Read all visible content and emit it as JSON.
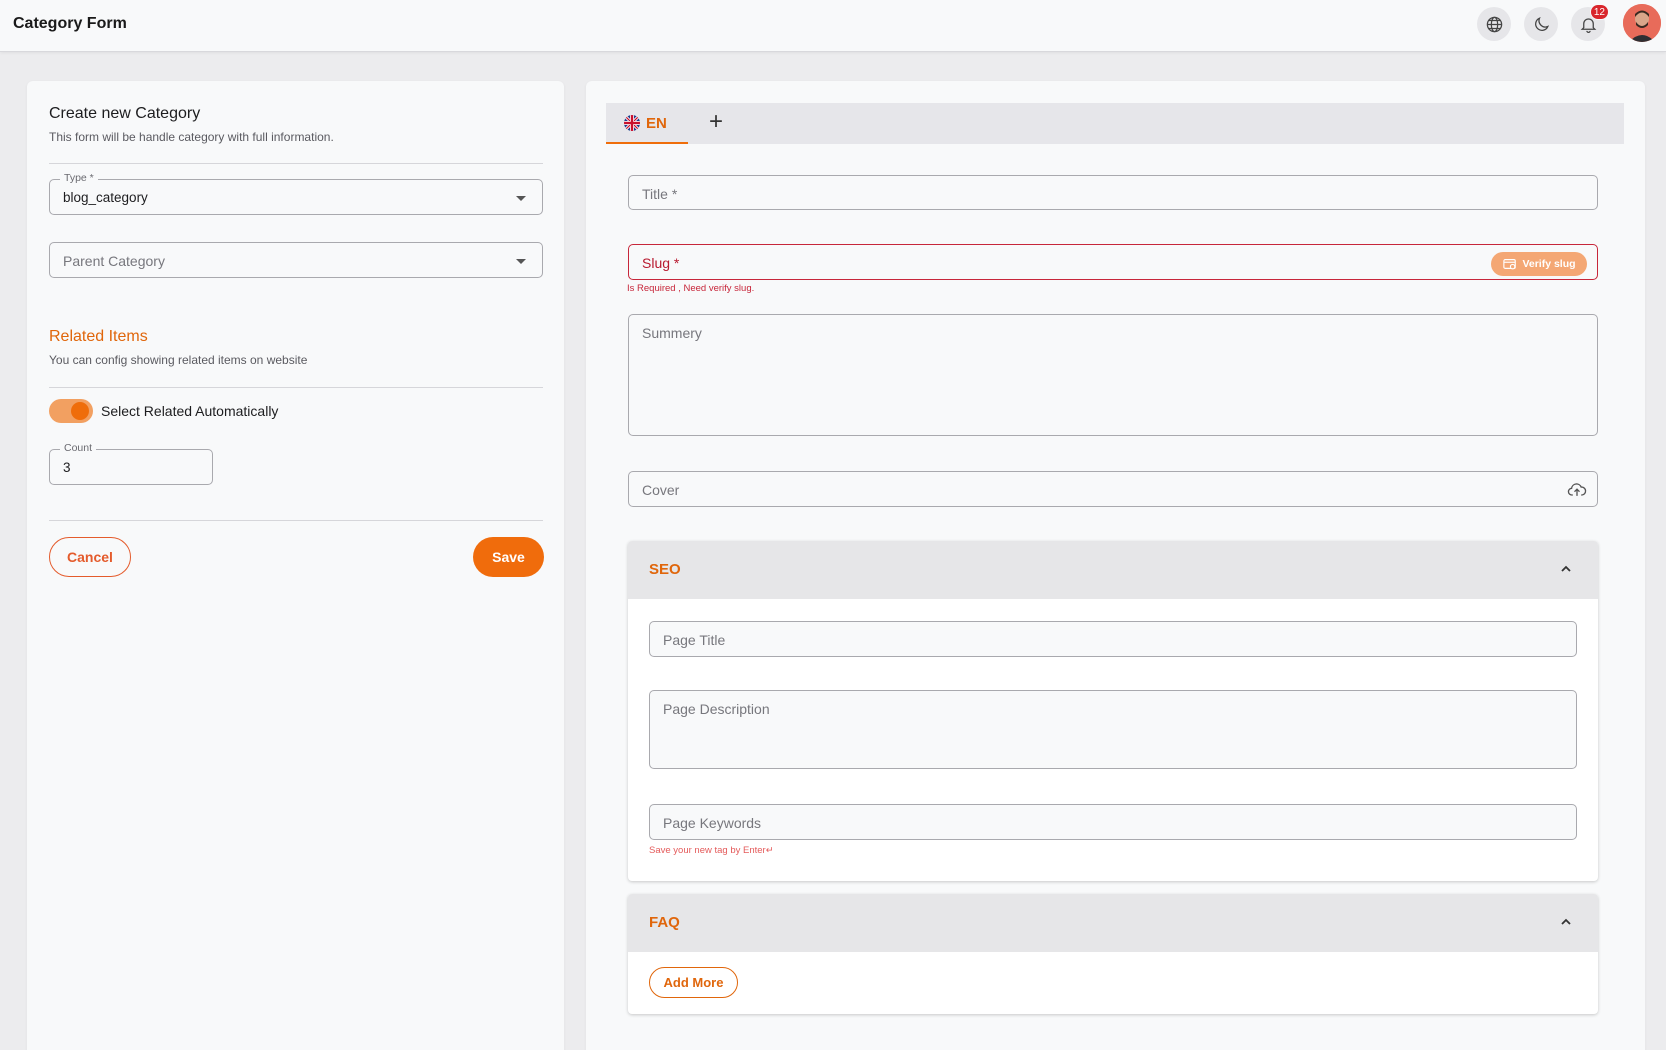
{
  "header": {
    "title": "Category Form",
    "notifications_count": "12"
  },
  "left": {
    "create_title": "Create new Category",
    "create_subtitle": "This form will be handle category with full information.",
    "type_field": {
      "label": "Type *",
      "value": "blog_category"
    },
    "parent_field": {
      "placeholder": "Parent Category"
    },
    "related_title": "Related Items",
    "related_subtitle": "You can config showing related items on website",
    "toggle_label": "Select Related Automatically",
    "toggle_on": true,
    "count_field": {
      "label": "Count",
      "value": "3"
    },
    "cancel_label": "Cancel",
    "save_label": "Save"
  },
  "right": {
    "tabs": [
      {
        "label": "EN"
      }
    ],
    "add_tab_symbol": "+",
    "title_field": {
      "placeholder": "Title *"
    },
    "slug_field": {
      "placeholder": "Slug *",
      "verify_label": "Verify slug",
      "error": "Is Required , Need verify slug."
    },
    "summary_field": {
      "placeholder": "Summery"
    },
    "cover_field": {
      "placeholder": "Cover"
    },
    "seo": {
      "title": "SEO",
      "page_title_placeholder": "Page Title",
      "page_description_placeholder": "Page Description",
      "page_keywords_placeholder": "Page Keywords",
      "keywords_hint": "Save your new tag by Enter↵"
    },
    "faq": {
      "title": "FAQ",
      "add_more_label": "Add More"
    }
  },
  "colors": {
    "accent": "#ef6d0a",
    "error": "#c7263a"
  },
  "icons": [
    "globe-icon",
    "moon-icon",
    "bell-icon",
    "avatar",
    "flag-uk-icon",
    "plus-icon",
    "caret-down-icon",
    "verify-icon",
    "cloud-upload-icon",
    "chevron-up-icon"
  ]
}
